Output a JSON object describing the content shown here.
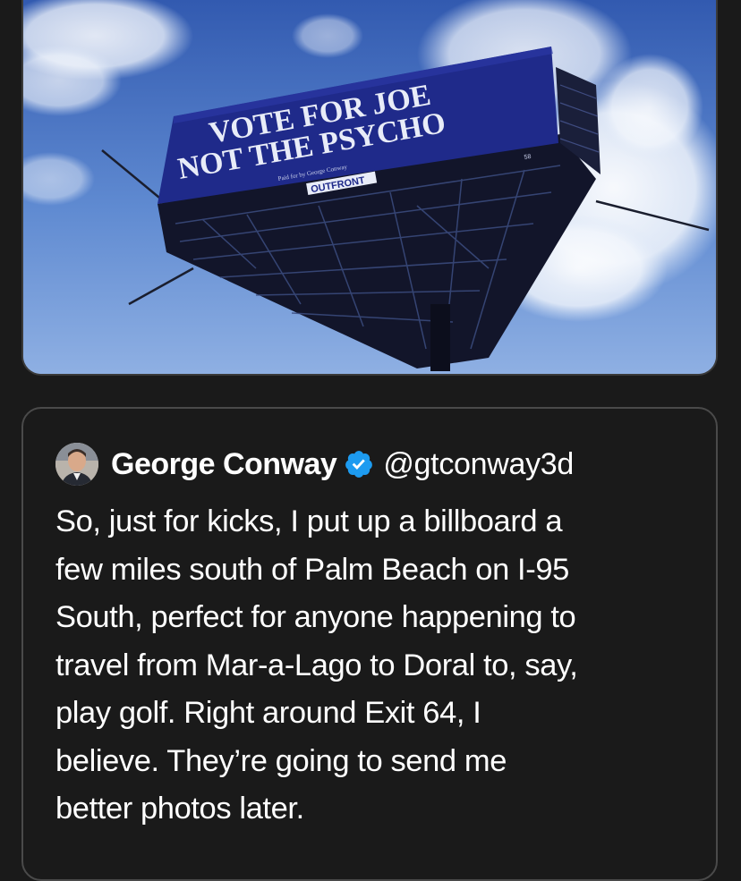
{
  "photo": {
    "billboard_line1": "VOTE FOR JOE",
    "billboard_line2": "NOT THE PSYCHO",
    "billboard_small_print": "Paid for by George Conway",
    "billboard_company": "OUTFRONT",
    "billboard_panel_number": "58"
  },
  "tweet": {
    "author_name": "George Conway",
    "author_handle": "@gtconway3d",
    "verified_icon": "verified-badge-icon",
    "text": "So, just for kicks, I put up a billboard a\nfew miles south of Palm Beach on I-95\nSouth, perfect for anyone happening to\ntravel from Mar-a-Lago to Doral to, say,\nplay golf.  Right around Exit 64, I\nbelieve.  They’re going to send me\nbetter photos later."
  },
  "colors": {
    "background": "#1a1a1a",
    "billboard_blue": "#1f2a8a",
    "verified_blue": "#1d9bf0",
    "text": "#ffffff"
  }
}
